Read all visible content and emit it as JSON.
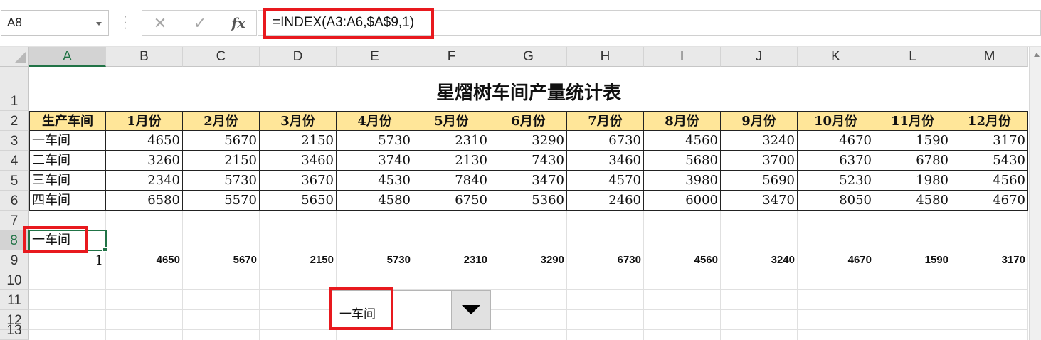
{
  "name_box": {
    "value": "A8"
  },
  "formula_bar": {
    "cancel_icon": "close-icon",
    "enter_icon": "check-icon",
    "function_label": "fx",
    "formula": "=INDEX(A3:A6,$A$9,1)"
  },
  "columns": [
    "A",
    "B",
    "C",
    "D",
    "E",
    "F",
    "G",
    "H",
    "I",
    "J",
    "K",
    "L",
    "M"
  ],
  "rows": [
    "1",
    "2",
    "3",
    "4",
    "5",
    "6",
    "7",
    "8",
    "9",
    "10",
    "11",
    "12",
    "13"
  ],
  "sheet": {
    "title": "星熠树车间产量统计表",
    "header": [
      "生产车间",
      "1月份",
      "2月份",
      "3月份",
      "4月份",
      "5月份",
      "6月份",
      "7月份",
      "8月份",
      "9月份",
      "10月份",
      "11月份",
      "12月份"
    ],
    "data": [
      [
        "一车间",
        "4650",
        "5670",
        "2150",
        "5730",
        "2310",
        "3290",
        "6730",
        "4560",
        "3240",
        "4670",
        "1590",
        "3170"
      ],
      [
        "二车间",
        "3260",
        "2150",
        "3460",
        "3740",
        "2130",
        "7430",
        "3460",
        "5680",
        "3700",
        "6370",
        "6780",
        "5430"
      ],
      [
        "三车间",
        "2340",
        "5730",
        "3670",
        "4530",
        "7840",
        "3470",
        "4570",
        "3980",
        "5690",
        "5230",
        "1980",
        "4560"
      ],
      [
        "四车间",
        "6580",
        "5570",
        "5650",
        "4580",
        "6750",
        "5360",
        "2460",
        "6000",
        "3470",
        "8050",
        "4580",
        "4670"
      ]
    ],
    "a8_value": "一车间",
    "a9_value": "1",
    "row9": [
      "4650",
      "5670",
      "2150",
      "5730",
      "2310",
      "3290",
      "6730",
      "4560",
      "3240",
      "4670",
      "1590",
      "3170"
    ]
  },
  "dropdown": {
    "selected": "一车间"
  },
  "colors": {
    "header_fill": "#ffe699",
    "highlight": "#e8191e",
    "selection": "#217346"
  }
}
